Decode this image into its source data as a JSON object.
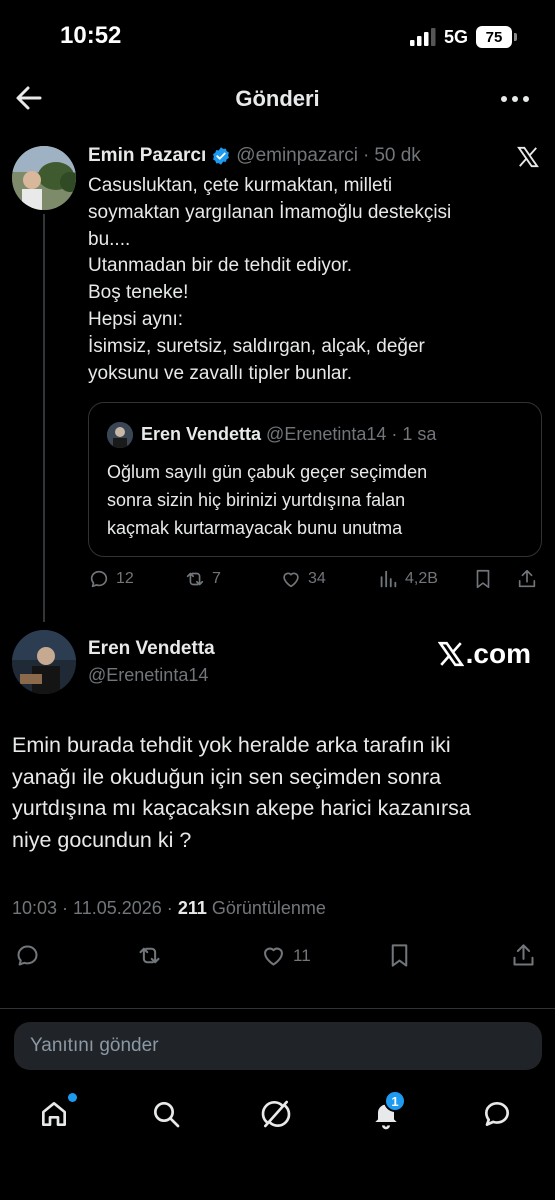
{
  "status_bar": {
    "time": "10:52",
    "network": "5G",
    "battery": "75"
  },
  "header": {
    "title": "Gönderi",
    "back_icon": "arrow-left-icon",
    "more_icon": "more-horizontal-icon"
  },
  "parent_tweet": {
    "author_name": "Emin Pazarcı",
    "handle": "@eminpazarci",
    "separator": "·",
    "time_ago": "50 dk",
    "verified": true,
    "lines": [
      "Casusluktan, çete kurmaktan, milleti",
      "soymaktan yargılanan İmamoğlu destekçisi",
      "bu....",
      "Utanmadan bir de tehdit ediyor.",
      "Boş teneke!",
      "Hepsi aynı:",
      "İsimsiz, suretsiz, saldırgan, alçak, değer",
      "yoksunu ve zavallı tipler bunlar."
    ],
    "quote": {
      "author_name": "Eren Vendetta",
      "handle": "@Erenetinta14",
      "separator": "·",
      "time_ago": "1 sa",
      "lines": [
        "Oğlum sayılı gün çabuk geçer seçimden",
        "sonra sizin hiç birinizi yurtdışına falan",
        "kaçmak kurtarmayacak bunu unutma"
      ]
    },
    "stats": {
      "replies": "12",
      "reposts": "7",
      "likes": "34",
      "views": "4,2B"
    }
  },
  "reply_tweet": {
    "author_name": "Eren Vendetta",
    "handle": "@Erenetinta14",
    "source_brand": ".com",
    "lines": [
      "Emin burada tehdit yok heralde arka tarafın iki",
      "yanağı ile okuduğun için sen seçimden sonra",
      "yurtdışına mı kaçacaksın akepe harici kazanırsa",
      "niye gocundun ki ?"
    ],
    "timestamp": "10:03 · 11.05.2026 ·",
    "views_count": "211",
    "views_label": "Görüntülenme",
    "likes": "11"
  },
  "composer": {
    "placeholder": "Yanıtını gönder"
  },
  "bottom_nav": {
    "notifications_badge": "1",
    "items": [
      "home-icon",
      "search-icon",
      "grok-icon",
      "notifications-icon",
      "messages-icon"
    ]
  },
  "colors": {
    "background": "#000000",
    "text": "#e7e9ea",
    "muted": "#71767b",
    "accent": "#1d9bf0",
    "border": "#2f3336"
  }
}
